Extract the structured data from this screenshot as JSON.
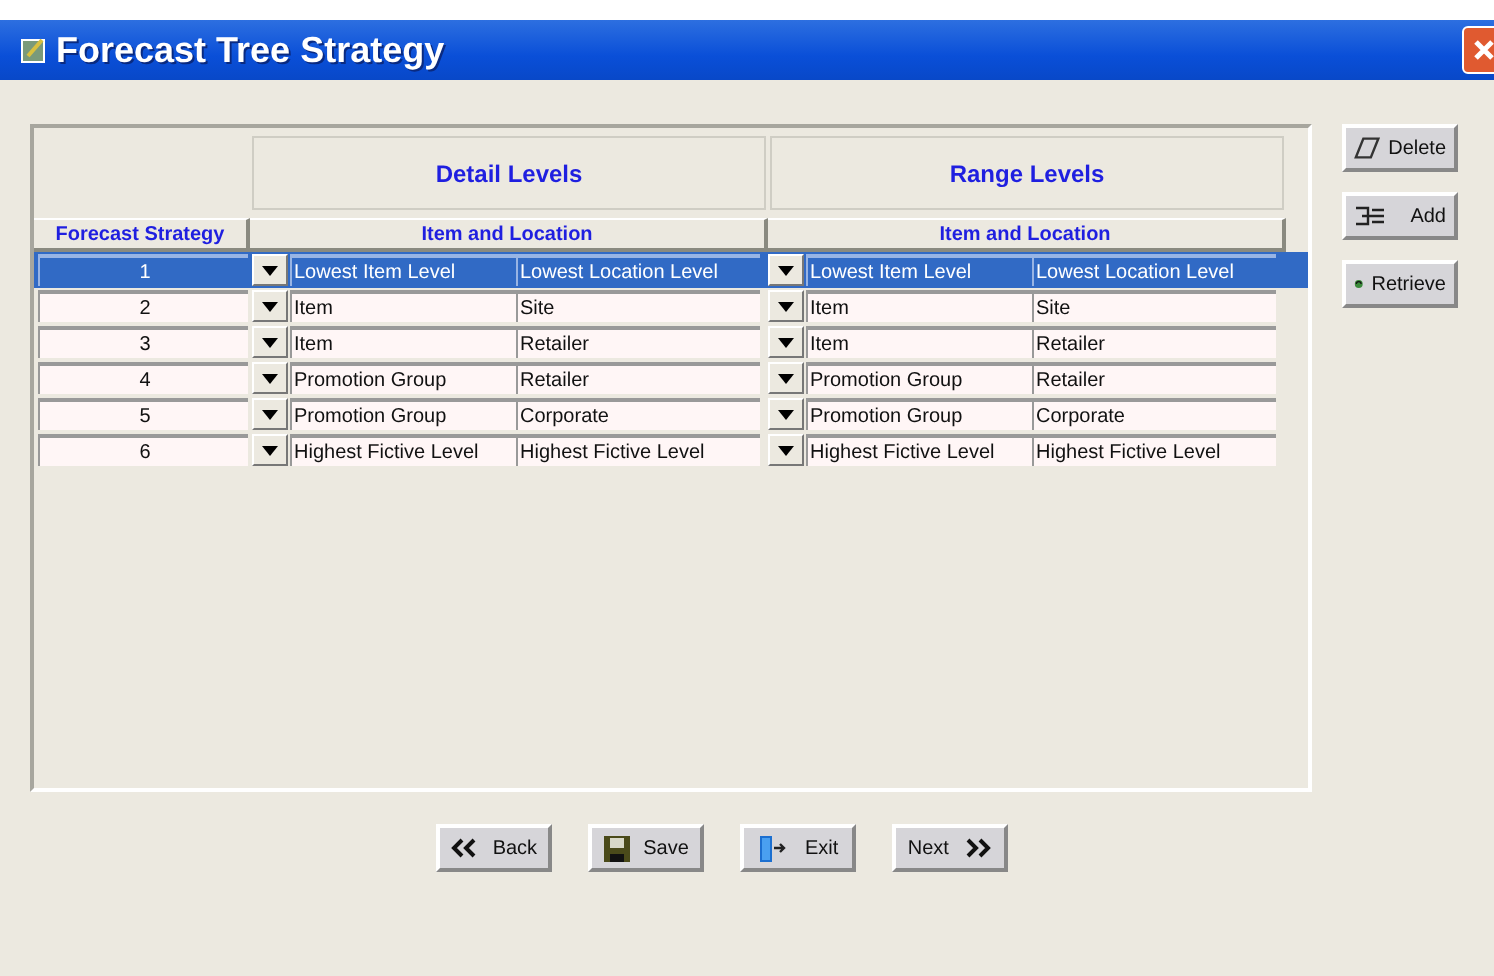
{
  "window": {
    "title": "Forecast Tree Strategy"
  },
  "table": {
    "group_headers": [
      "Detail Levels",
      "Range Levels"
    ],
    "columns": [
      "Forecast Strategy",
      "Item and Location",
      "Item and Location"
    ],
    "rows": [
      {
        "strategy": "1",
        "selected": true,
        "detail": [
          "Lowest Item Level",
          "Lowest Location Level"
        ],
        "range": [
          "Lowest Item Level",
          "Lowest Location Level"
        ]
      },
      {
        "strategy": "2",
        "selected": false,
        "detail": [
          "Item",
          "Site"
        ],
        "range": [
          "Item",
          "Site"
        ]
      },
      {
        "strategy": "3",
        "selected": false,
        "detail": [
          "Item",
          "Retailer"
        ],
        "range": [
          "Item",
          "Retailer"
        ]
      },
      {
        "strategy": "4",
        "selected": false,
        "detail": [
          "Promotion Group",
          "Retailer"
        ],
        "range": [
          "Promotion Group",
          "Retailer"
        ]
      },
      {
        "strategy": "5",
        "selected": false,
        "detail": [
          "Promotion Group",
          "Corporate"
        ],
        "range": [
          "Promotion Group",
          "Corporate"
        ]
      },
      {
        "strategy": "6",
        "selected": false,
        "detail": [
          "Highest Fictive Level",
          "Highest Fictive Level"
        ],
        "range": [
          "Highest Fictive Level",
          "Highest Fictive Level"
        ]
      }
    ]
  },
  "side_buttons": [
    {
      "label": "Delete",
      "kind": "delete"
    },
    {
      "label": "Add",
      "kind": "add"
    },
    {
      "label": "Retrieve",
      "kind": "retrieve"
    }
  ],
  "nav_buttons": [
    {
      "label": "Back",
      "kind": "back"
    },
    {
      "label": "Save",
      "kind": "save"
    },
    {
      "label": "Exit",
      "kind": "exit"
    },
    {
      "label": "Next",
      "kind": "next"
    }
  ]
}
